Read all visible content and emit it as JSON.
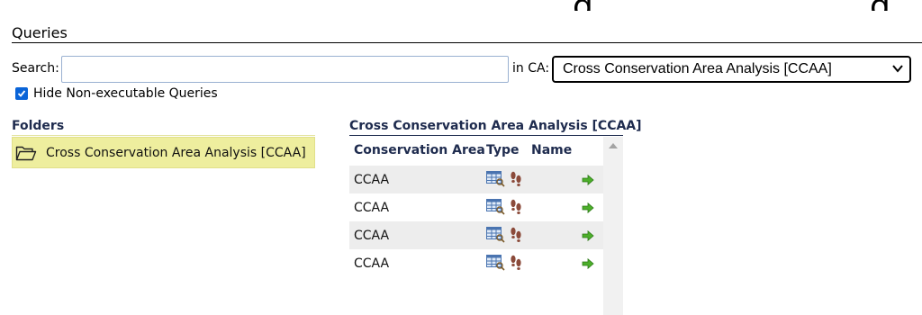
{
  "queries": {
    "title": "Queries",
    "search_label": "Search:",
    "search_value": "",
    "ca_label": "in CA:",
    "ca_selected": "Cross Conservation Area Analysis [CCAA]",
    "hide_nonexec_label": "Hide Non-executable Queries",
    "hide_nonexec_checked": true
  },
  "folders": {
    "title": "Folders",
    "items": [
      {
        "label": "Cross Conservation Area Analysis [CCAA]",
        "icon": "folder-open-icon",
        "selected": true
      }
    ]
  },
  "results": {
    "title": "Cross Conservation Area Analysis [CCAA]",
    "columns": [
      "Conservation Area",
      "Type",
      "Name"
    ],
    "rows": [
      {
        "ca": "CCAA",
        "type_icons": [
          "table-query-icon",
          "footprints-icon"
        ],
        "action_icon": "run-arrow-icon"
      },
      {
        "ca": "CCAA",
        "type_icons": [
          "table-query-icon",
          "footprints-icon"
        ],
        "action_icon": "run-arrow-icon"
      },
      {
        "ca": "CCAA",
        "type_icons": [
          "table-query-icon",
          "footprints-icon"
        ],
        "action_icon": "run-arrow-icon"
      },
      {
        "ca": "CCAA",
        "type_icons": [
          "table-query-icon",
          "footprints-icon"
        ],
        "action_icon": "run-arrow-icon"
      }
    ]
  },
  "colors": {
    "heading": "#1e2b4e",
    "folder_highlight": "#eeee9e",
    "row_alt": "#ededed",
    "checkbox": "#0a64d8",
    "run_arrow": "#4caf2a"
  }
}
